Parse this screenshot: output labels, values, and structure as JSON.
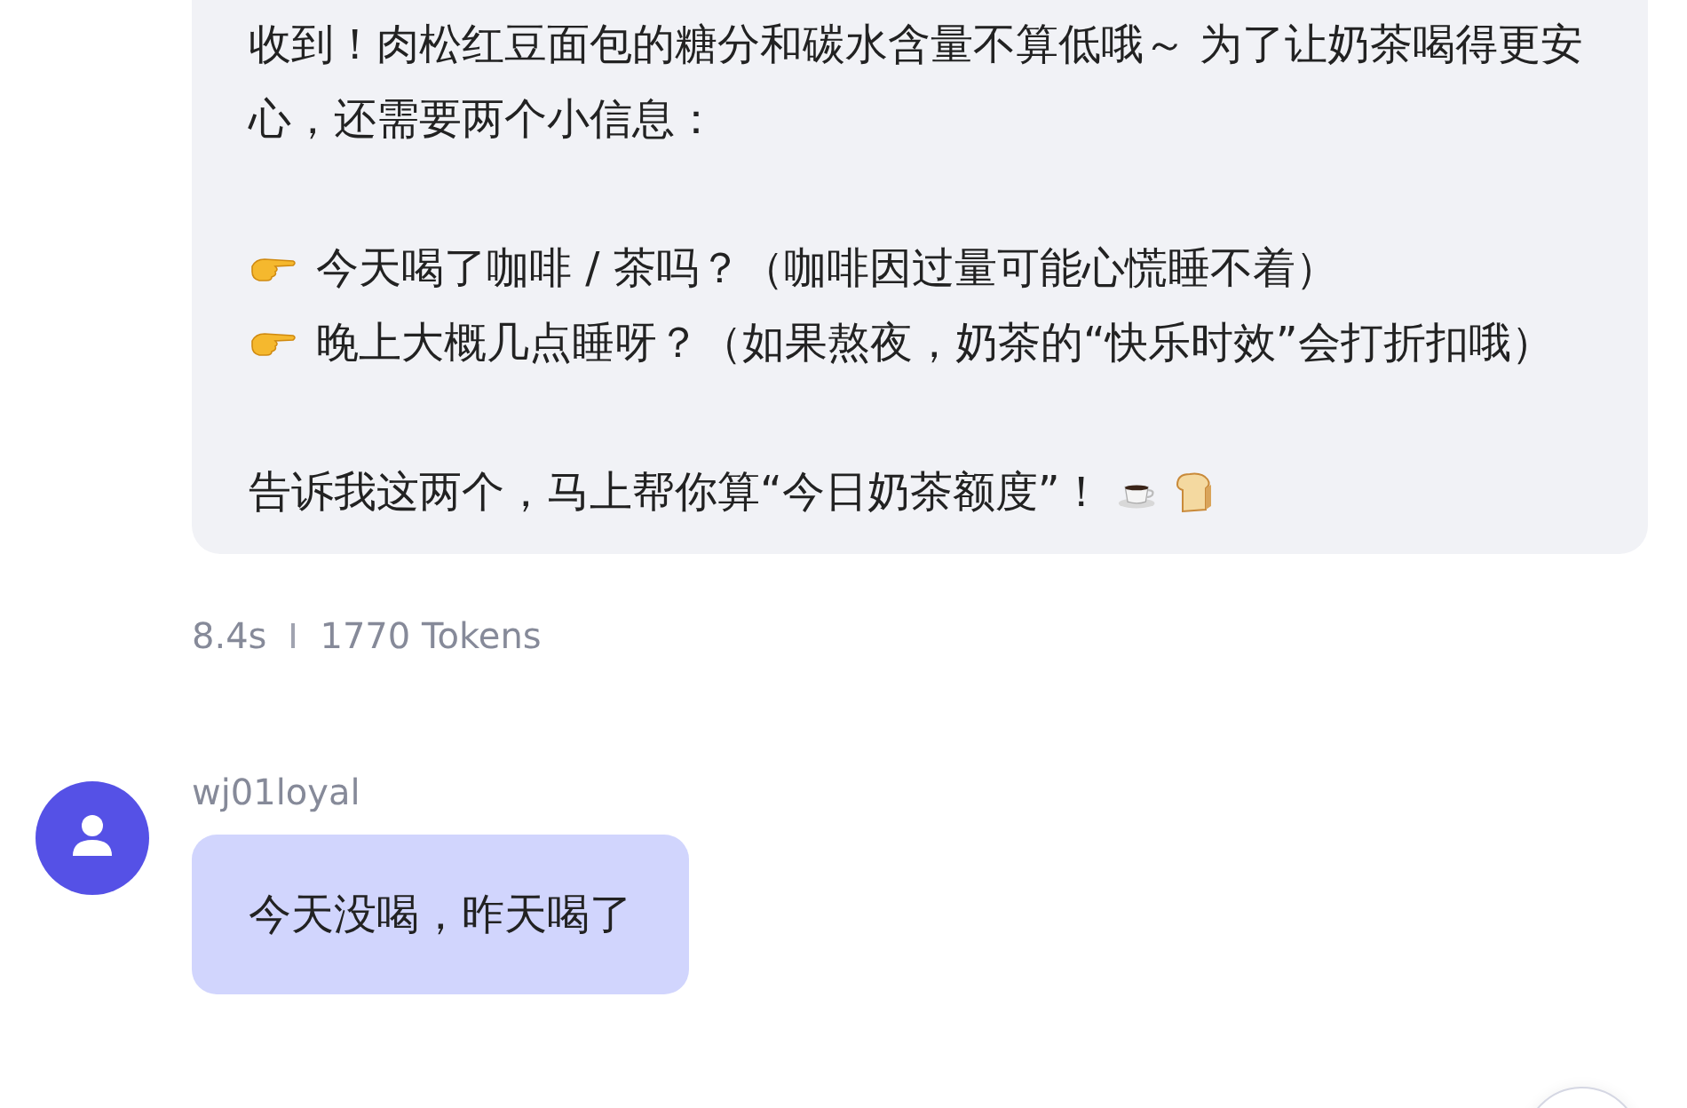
{
  "messages": [
    {
      "kind": "assistant",
      "blocks": [
        {
          "kind": "text",
          "text": "收到！肉松红豆面包的糖分和碳水含量不算低哦～ 为了让奶茶喝得更安心，还需要两个小信息："
        },
        {
          "kind": "bullets",
          "items": [
            "今天喝了咖啡 / 茶吗？（咖啡因过量可能心慌睡不着）",
            "晚上大概几点睡呀？（如果熬夜，奶茶的“快乐时效”会打折扣哦）"
          ]
        },
        {
          "kind": "closing",
          "text": "告诉我这两个，马上帮你算“今日奶茶额度”！"
        }
      ],
      "meta": {
        "time": "8.4s",
        "tokens": "1770 Tokens"
      }
    },
    {
      "kind": "user",
      "username": "wj01loyal",
      "blocks": [
        {
          "kind": "text",
          "text": "今天没喝，昨天喝了"
        }
      ]
    }
  ]
}
